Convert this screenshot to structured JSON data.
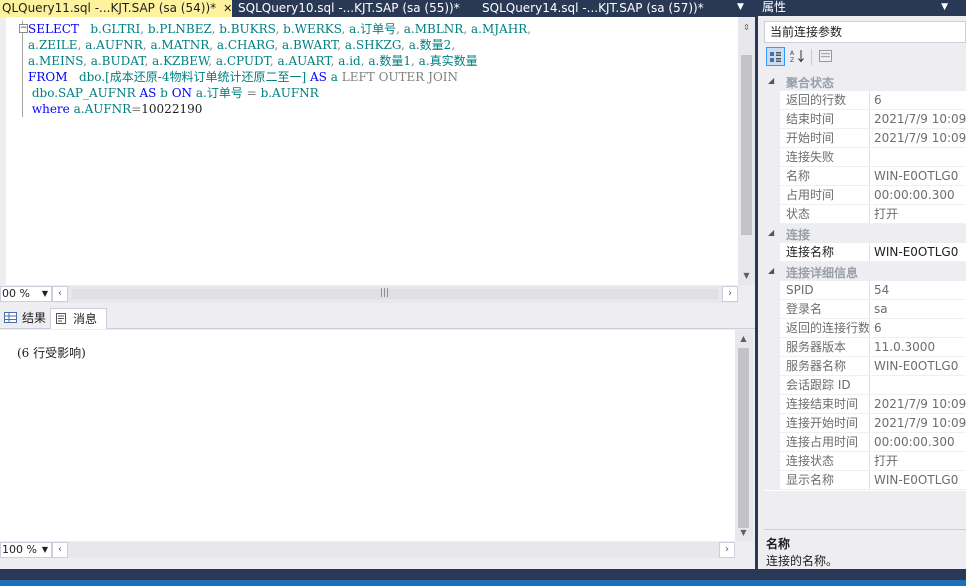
{
  "tabs": [
    {
      "label": "QLQuery11.sql -...KJT.SAP (sa (54))*",
      "active": true,
      "close": "✕"
    },
    {
      "label": "SQLQuery10.sql -...KJT.SAP (sa (55))*",
      "active": false
    },
    {
      "label": "SQLQuery14.sql -...KJT.SAP (sa (57))*",
      "active": false
    }
  ],
  "editor": {
    "code_lines": [
      [
        [
          "kw",
          "SELECT   "
        ],
        [
          "id",
          "b.GLTRI"
        ],
        [
          "op",
          ", "
        ],
        [
          "id",
          "b.PLNBEZ"
        ],
        [
          "op",
          ", "
        ],
        [
          "id",
          "b.BUKRS"
        ],
        [
          "op",
          ", "
        ],
        [
          "id",
          "b.WERKS"
        ],
        [
          "op",
          ", "
        ],
        [
          "id",
          "a.订单号"
        ],
        [
          "op",
          ", "
        ],
        [
          "id",
          "a.MBLNR"
        ],
        [
          "op",
          ", "
        ],
        [
          "id",
          "a.MJAHR"
        ],
        [
          "op",
          ","
        ]
      ],
      [
        [
          "id",
          "a.ZEILE"
        ],
        [
          "op",
          ", "
        ],
        [
          "id",
          "a.AUFNR"
        ],
        [
          "op",
          ", "
        ],
        [
          "id",
          "a.MATNR"
        ],
        [
          "op",
          ", "
        ],
        [
          "id",
          "a.CHARG"
        ],
        [
          "op",
          ", "
        ],
        [
          "id",
          "a.BWART"
        ],
        [
          "op",
          ", "
        ],
        [
          "id",
          "a.SHKZG"
        ],
        [
          "op",
          ", "
        ],
        [
          "id",
          "a.数量2"
        ],
        [
          "op",
          ","
        ]
      ],
      [
        [
          "id",
          "a.MEINS"
        ],
        [
          "op",
          ", "
        ],
        [
          "id",
          "a.BUDAT"
        ],
        [
          "op",
          ", "
        ],
        [
          "id",
          "a.KZBEW"
        ],
        [
          "op",
          ", "
        ],
        [
          "id",
          "a.CPUDT"
        ],
        [
          "op",
          ", "
        ],
        [
          "id",
          "a.AUART"
        ],
        [
          "op",
          ", "
        ],
        [
          "id",
          "a.id"
        ],
        [
          "op",
          ", "
        ],
        [
          "id",
          "a.数量1"
        ],
        [
          "op",
          ", "
        ],
        [
          "id",
          "a.真实数量"
        ]
      ],
      [
        [
          "kw",
          "FROM   "
        ],
        [
          "id",
          "dbo.[成本还原-4物料订单统计还原二至一]"
        ],
        [
          "cm",
          " "
        ],
        [
          "kw",
          "AS"
        ],
        [
          "cm",
          " "
        ],
        [
          "id",
          "a"
        ],
        [
          "cm",
          " "
        ],
        [
          "op",
          "LEFT OUTER JOIN"
        ]
      ],
      [
        [
          "cm",
          " "
        ],
        [
          "id",
          "dbo.SAP_AUFNR"
        ],
        [
          "cm",
          " "
        ],
        [
          "kw",
          "AS"
        ],
        [
          "cm",
          " "
        ],
        [
          "id",
          "b"
        ],
        [
          "cm",
          " "
        ],
        [
          "kw",
          "ON"
        ],
        [
          "cm",
          " "
        ],
        [
          "id",
          "a.订单号"
        ],
        [
          "cm",
          " "
        ],
        [
          "op",
          "="
        ],
        [
          "cm",
          " "
        ],
        [
          "id",
          "b.AUFNR"
        ]
      ],
      [
        [
          "cm",
          " "
        ],
        [
          "kw",
          "where"
        ],
        [
          "cm",
          " "
        ],
        [
          "id",
          "a.AUFNR"
        ],
        [
          "op",
          "="
        ],
        [
          "cm",
          "10022190"
        ]
      ]
    ]
  },
  "zoom_top": "00 %",
  "zoom_bottom": "100 %",
  "results_tabs": {
    "results": "结果",
    "messages": "消息"
  },
  "messages_text": "(6 行受影响)",
  "properties": {
    "title": "属性",
    "object": "当前连接参数",
    "categories": [
      {
        "label": "聚合状态",
        "rows": [
          {
            "name": "返回的行数",
            "value": "6"
          },
          {
            "name": "结束时间",
            "value": "2021/7/9 10:09"
          },
          {
            "name": "开始时间",
            "value": "2021/7/9 10:09"
          },
          {
            "name": "连接失败",
            "value": ""
          },
          {
            "name": "名称",
            "value": "WIN-E0OTLG0"
          },
          {
            "name": "占用时间",
            "value": "00:00:00.300"
          },
          {
            "name": "状态",
            "value": "打开"
          }
        ]
      },
      {
        "label": "连接",
        "rows": [
          {
            "name": "连接名称",
            "value": "WIN-E0OTLG0",
            "bold": true
          }
        ]
      },
      {
        "label": "连接详细信息",
        "rows": [
          {
            "name": "SPID",
            "value": "54"
          },
          {
            "name": "登录名",
            "value": "sa"
          },
          {
            "name": "返回的连接行数",
            "value": "6"
          },
          {
            "name": "服务器版本",
            "value": "11.0.3000"
          },
          {
            "name": "服务器名称",
            "value": "WIN-E0OTLG0"
          },
          {
            "name": "会话跟踪 ID",
            "value": ""
          },
          {
            "name": "连接结束时间",
            "value": "2021/7/9 10:09"
          },
          {
            "name": "连接开始时间",
            "value": "2021/7/9 10:09"
          },
          {
            "name": "连接占用时间",
            "value": "00:00:00.300"
          },
          {
            "name": "连接状态",
            "value": "打开"
          },
          {
            "name": "显示名称",
            "value": "WIN-E0OTLG0"
          }
        ]
      }
    ],
    "description_title": "名称",
    "description_text": "连接的名称。"
  }
}
